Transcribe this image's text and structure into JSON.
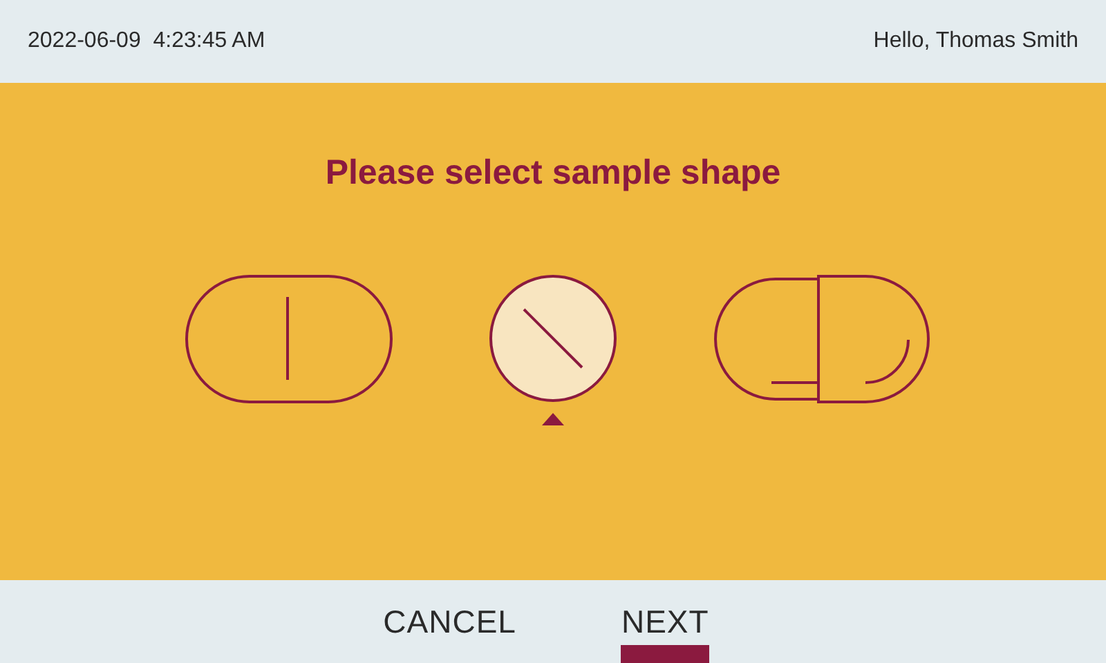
{
  "header": {
    "datetime": "2022-06-09  4:23:45 AM",
    "greeting": "Hello, Thomas Smith"
  },
  "title": "Please select sample shape",
  "shapes": [
    {
      "kind": "split-capsule",
      "selected": false
    },
    {
      "kind": "round",
      "selected": true
    },
    {
      "kind": "capsule",
      "selected": false
    }
  ],
  "buttons": [
    {
      "label": "CANCEL",
      "selected": false
    },
    {
      "label": "NEXT",
      "selected": true
    }
  ]
}
